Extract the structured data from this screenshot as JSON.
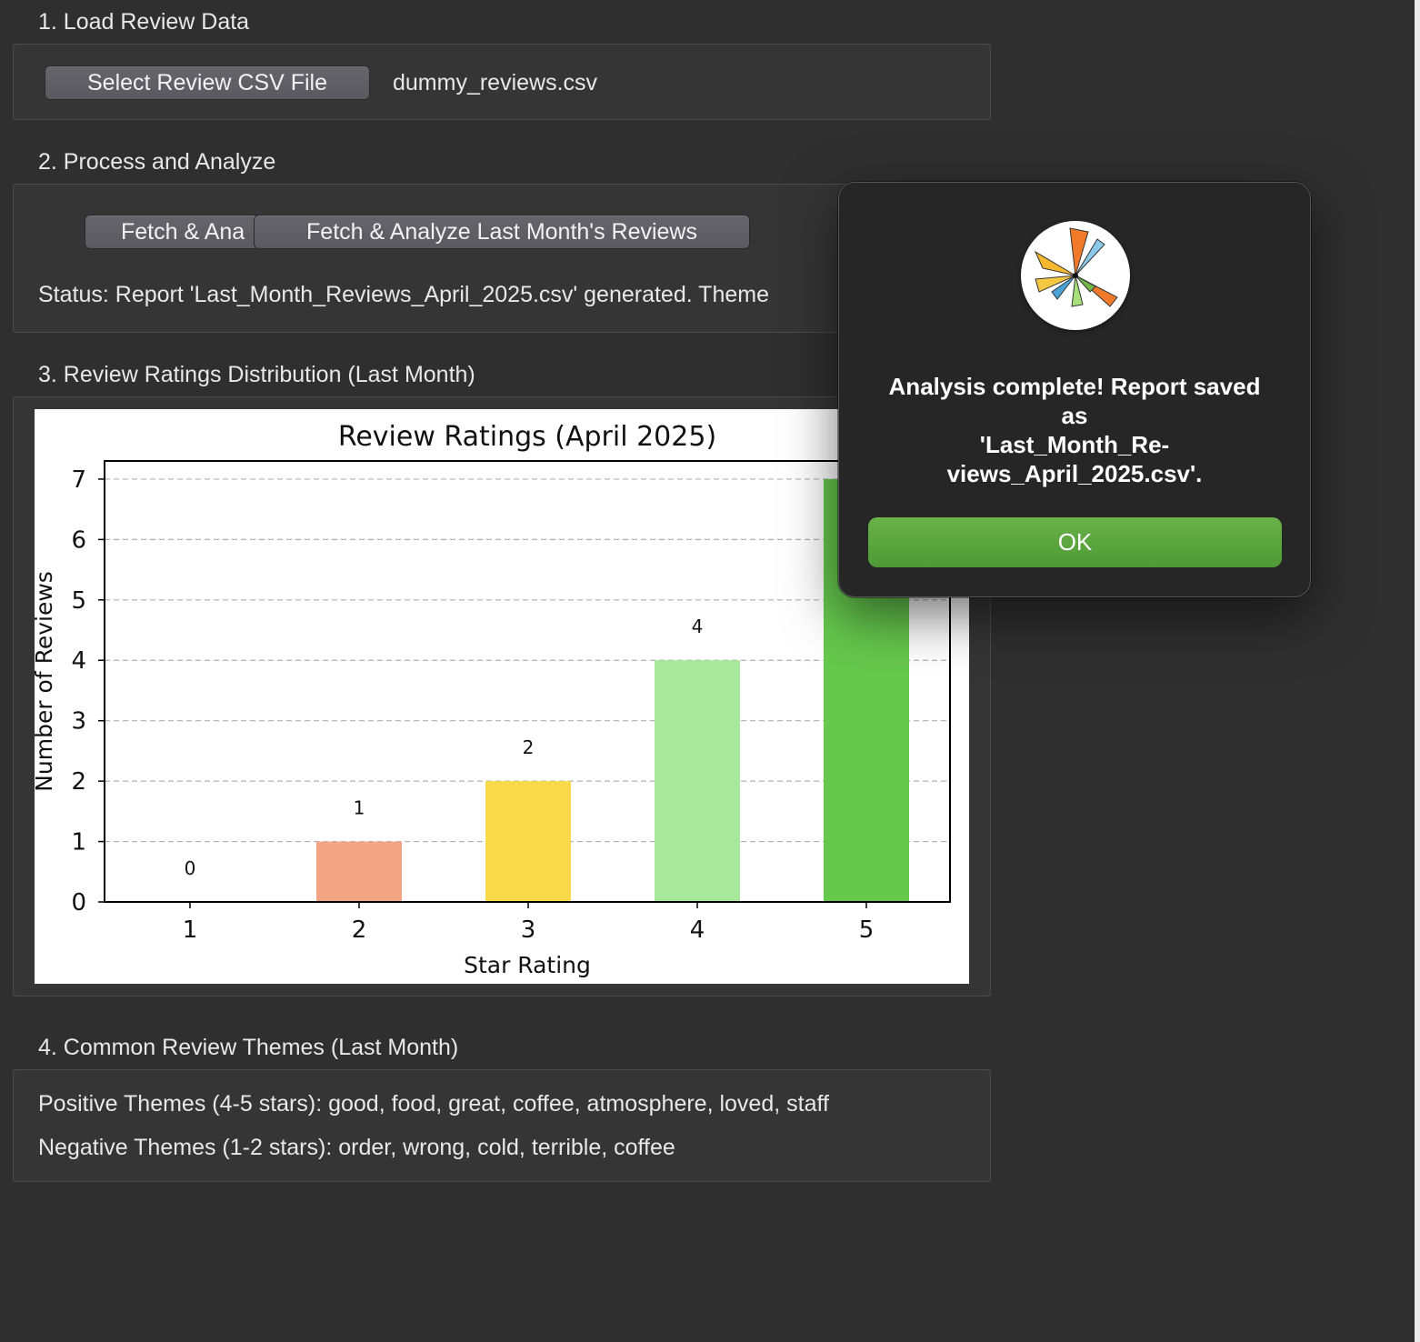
{
  "sections": {
    "load": {
      "title": "1. Load Review Data",
      "select_button": "Select Review CSV File",
      "file_name": "dummy_reviews.csv"
    },
    "process": {
      "title": "2. Process and Analyze",
      "fetch_button_partial": "Fetch & Ana",
      "fetch_button": "Fetch & Analyze Last Month's Reviews",
      "status": "Status: Report 'Last_Month_Reviews_April_2025.csv' generated. Theme"
    },
    "distribution": {
      "title": "3. Review Ratings Distribution (Last Month)"
    },
    "themes": {
      "title": "4. Common Review Themes (Last Month)",
      "positive": "Positive Themes (4-5 stars): good, food, great, coffee, atmosphere, loved, staff",
      "negative": "Negative Themes (1-2 stars): order, wrong, cold, terrible, coffee"
    }
  },
  "chart_data": {
    "type": "bar",
    "title": "Review Ratings (April 2025)",
    "xlabel": "Star Rating",
    "ylabel": "Number of Reviews",
    "categories": [
      "1",
      "2",
      "3",
      "4",
      "5"
    ],
    "values": [
      0,
      1,
      2,
      4,
      7
    ],
    "data_labels": [
      "0",
      "1",
      "2",
      "4",
      "7"
    ],
    "colors": [
      "#e74c3c",
      "#f2a484",
      "#f9d94a",
      "#a7e89a",
      "#66c84d"
    ],
    "ylim": [
      0,
      7.3
    ],
    "yticks": [
      "0",
      "1",
      "2",
      "3",
      "4",
      "5",
      "6",
      "7"
    ],
    "grid": "horizontal dashed"
  },
  "dialog": {
    "icon": "rose-chart-app-icon",
    "message_lines": [
      "Analysis complete! Report saved",
      "as",
      "'Last_Month_Re-",
      "views_April_2025.csv'."
    ],
    "ok_label": "OK",
    "ok_color": "#5ca640"
  }
}
